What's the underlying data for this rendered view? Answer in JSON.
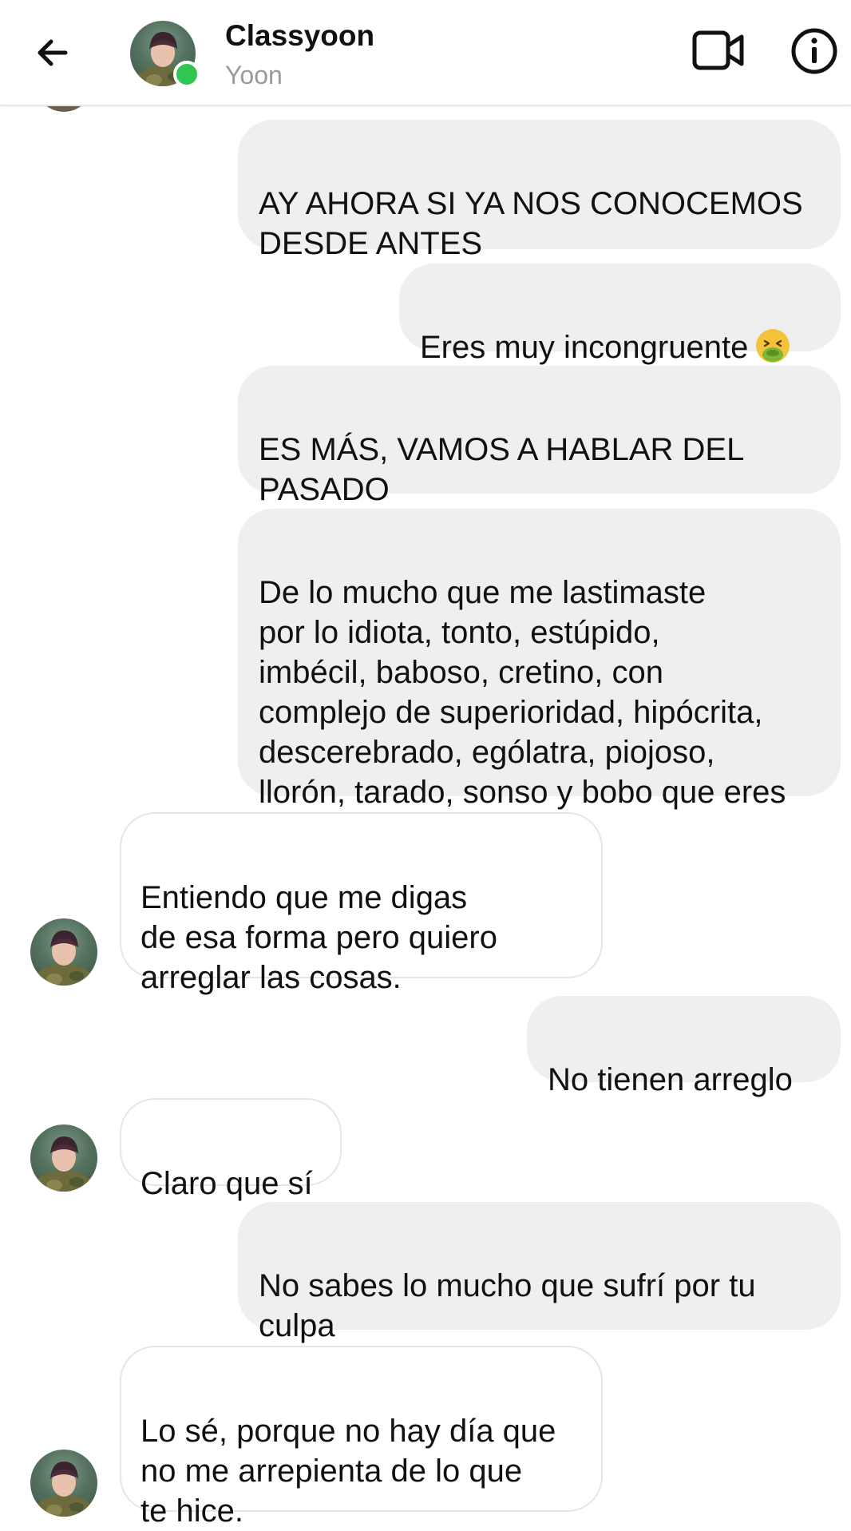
{
  "header": {
    "name": "Classyoon",
    "subtitle": "Yoon",
    "icons": {
      "back": "back-arrow-icon",
      "video": "video-camera-icon",
      "info": "info-icon"
    },
    "online_color": "#31c552"
  },
  "messages": [
    {
      "side": "out",
      "text": "AY AHORA SI YA NOS CONOCEMOS\nDESDE ANTES"
    },
    {
      "side": "out",
      "text": "Eres muy incongruente",
      "emoji": "nauseated-face-emoji"
    },
    {
      "side": "out",
      "text": "ES MÁS, VAMOS A HABLAR DEL\nPASADO"
    },
    {
      "side": "out",
      "text": "De lo mucho que me lastimaste\npor lo idiota, tonto, estúpido,\nimbécil, baboso, cretino, con\ncomplejo de superioridad, hipócrita,\ndescerebrado, ególatra, piojoso,\nllorón, tarado, sonso y bobo que eres"
    },
    {
      "side": "in",
      "text": "Entiendo que me digas\nde esa forma pero quiero\narreglar las cosas."
    },
    {
      "side": "out",
      "text": "No tienen arreglo"
    },
    {
      "side": "in",
      "text": "Claro que sí"
    },
    {
      "side": "out",
      "text": "No sabes lo mucho que sufrí por tu\nculpa"
    },
    {
      "side": "in",
      "text": "Lo sé, porque no hay día que\nno me arrepienta de lo que\nte hice."
    }
  ],
  "colors": {
    "outgoing_bubble": "#efefef",
    "incoming_border": "#e6e6e6",
    "subtitle": "#9a9a9a"
  }
}
